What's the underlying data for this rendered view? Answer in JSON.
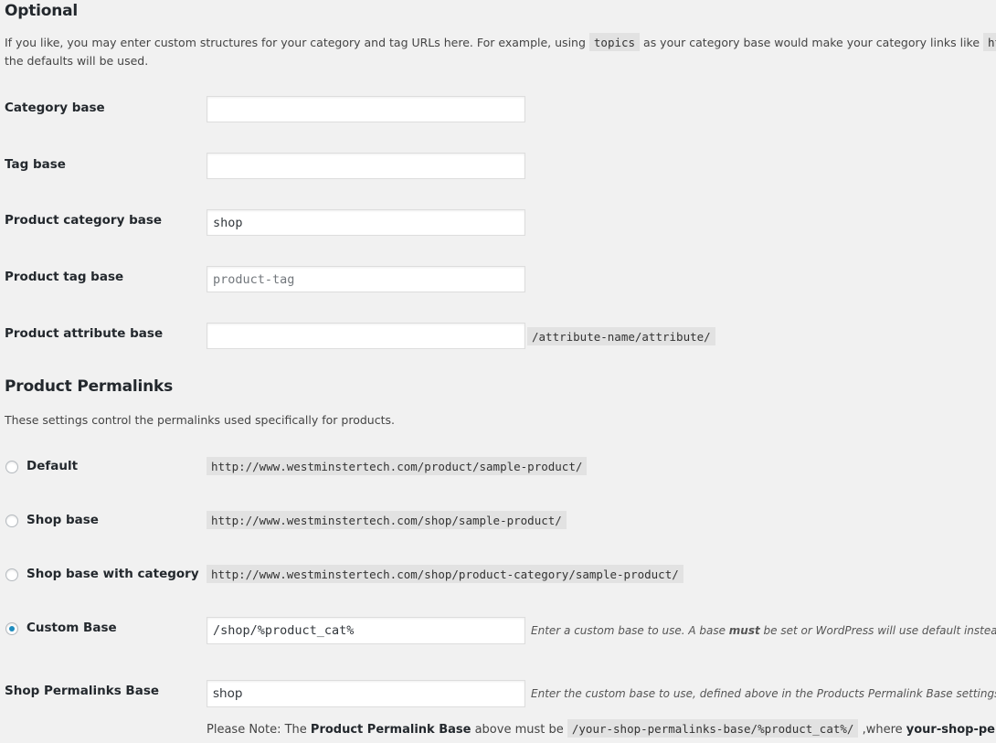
{
  "optional": {
    "title": "Optional",
    "description_before": "If you like, you may enter custom structures for your category and tag URLs here. For example, using",
    "description_code": "topics",
    "description_after": "as your category base would make your category links like",
    "description_code2": "http://",
    "description_line2": "the defaults will be used.",
    "fields": [
      {
        "label": "Category base",
        "value": "",
        "placeholder": ""
      },
      {
        "label": "Tag base",
        "value": "",
        "placeholder": ""
      },
      {
        "label": "Product category base",
        "value": "shop",
        "placeholder": ""
      },
      {
        "label": "Product tag base",
        "value": "",
        "placeholder": "product-tag"
      },
      {
        "label": "Product attribute base",
        "value": "",
        "placeholder": "",
        "suffix": "/attribute-name/attribute/"
      }
    ]
  },
  "product_permalinks": {
    "title": "Product Permalinks",
    "description": "These settings control the permalinks used specifically for products.",
    "options": [
      {
        "label": "Default",
        "example": "http://www.westminstertech.com/product/sample-product/",
        "checked": false
      },
      {
        "label": "Shop base",
        "example": "http://www.westminstertech.com/shop/sample-product/",
        "checked": false
      },
      {
        "label": "Shop base with category",
        "example": "http://www.westminstertech.com/shop/product-category/sample-product/",
        "checked": false
      },
      {
        "label": "Custom Base",
        "value": "/shop/%product_cat%",
        "checked": true,
        "hint_before": "Enter a custom base to use. A base ",
        "hint_bold": "must",
        "hint_after": " be set or WordPress will use default instead."
      }
    ],
    "shop_base": {
      "label": "Shop Permalinks Base",
      "value": "shop",
      "hint": "Enter the custom base to use, defined above in the Products Permalink Base settings, eg. p"
    },
    "note": {
      "prefix": "Please Note: The ",
      "bold1": "Product Permalink Base",
      "middle": " above must be ",
      "code": "/your-shop-permalinks-base/%product_cat%/",
      "after": " ,where ",
      "bold2": "your-shop-perm"
    }
  },
  "colors": {
    "background": "#f1f1f1",
    "radio_checked": "#1e8cbe",
    "code_bg": "#e2e2e2"
  }
}
